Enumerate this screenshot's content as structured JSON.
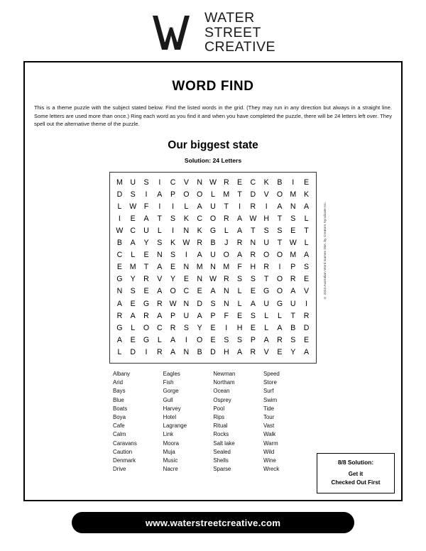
{
  "brand": {
    "logo_icon": "w-monogram-logo",
    "name_lines": [
      "WATER",
      "STREET",
      "CREATIVE"
    ]
  },
  "puzzle": {
    "title": "WORD FIND",
    "instructions": "This is a theme puzzle with the subject stated below. Find the listed words in the grid. (They may run in any direction but always in a straight line. Some letters are used more than once.) Ring each word as you find it and when you have completed the puzzle, there will be 24 letters left over. They spell out the alternative theme of the puzzle.",
    "theme": "Our biggest state",
    "solution_count": "Solution: 24 Letters",
    "copyright": "© 2024 Australian Word Games Dist. by Creators Syndicate Inc.",
    "grid": [
      [
        "M",
        "U",
        "S",
        "I",
        "C",
        "V",
        "N",
        "W",
        "R",
        "E",
        "C",
        "K",
        "B",
        "I",
        "E"
      ],
      [
        "D",
        "S",
        "I",
        "A",
        "P",
        "O",
        "O",
        "L",
        "M",
        "T",
        "D",
        "V",
        "O",
        "M",
        "K"
      ],
      [
        "L",
        "W",
        "F",
        "I",
        "I",
        "L",
        "A",
        "U",
        "T",
        "I",
        "R",
        "I",
        "A",
        "N",
        "A"
      ],
      [
        "I",
        "E",
        "A",
        "T",
        "S",
        "K",
        "C",
        "O",
        "R",
        "A",
        "W",
        "H",
        "T",
        "S",
        "L"
      ],
      [
        "W",
        "C",
        "U",
        "L",
        "I",
        "N",
        "K",
        "G",
        "L",
        "A",
        "T",
        "S",
        "S",
        "E",
        "T"
      ],
      [
        "B",
        "A",
        "Y",
        "S",
        "K",
        "W",
        "R",
        "B",
        "J",
        "R",
        "N",
        "U",
        "T",
        "W",
        "L"
      ],
      [
        "C",
        "L",
        "E",
        "N",
        "S",
        "I",
        "A",
        "U",
        "O",
        "A",
        "R",
        "O",
        "O",
        "M",
        "A"
      ],
      [
        "E",
        "M",
        "T",
        "A",
        "E",
        "N",
        "M",
        "N",
        "M",
        "F",
        "H",
        "R",
        "I",
        "P",
        "S"
      ],
      [
        "G",
        "Y",
        "R",
        "V",
        "Y",
        "E",
        "N",
        "W",
        "R",
        "S",
        "S",
        "T",
        "O",
        "R",
        "E"
      ],
      [
        "N",
        "S",
        "E",
        "A",
        "O",
        "C",
        "E",
        "A",
        "N",
        "L",
        "E",
        "G",
        "O",
        "A",
        "V"
      ],
      [
        "A",
        "E",
        "G",
        "R",
        "W",
        "N",
        "D",
        "S",
        "N",
        "L",
        "A",
        "U",
        "G",
        "U",
        "I"
      ],
      [
        "R",
        "A",
        "R",
        "A",
        "P",
        "U",
        "A",
        "P",
        "F",
        "E",
        "S",
        "L",
        "L",
        "T",
        "R"
      ],
      [
        "G",
        "L",
        "O",
        "C",
        "R",
        "S",
        "Y",
        "E",
        "I",
        "H",
        "E",
        "L",
        "A",
        "B",
        "D"
      ],
      [
        "A",
        "E",
        "G",
        "L",
        "A",
        "I",
        "O",
        "E",
        "S",
        "S",
        "P",
        "A",
        "R",
        "S",
        "E"
      ],
      [
        "L",
        "D",
        "I",
        "R",
        "A",
        "N",
        "B",
        "D",
        "H",
        "A",
        "R",
        "V",
        "E",
        "Y",
        "A"
      ]
    ],
    "word_columns": [
      [
        "Albany",
        "Arid",
        "Bays",
        "Blue",
        "Boats",
        "Boya",
        "Cafe",
        "Calm",
        "Caravans",
        "Caution",
        "Denmark",
        "Drive"
      ],
      [
        "Eagles",
        "Fish",
        "Gorge",
        "Gull",
        "Harvey",
        "Hotel",
        "Lagrange",
        "Link",
        "Moora",
        "Muja",
        "Music",
        "Nacre"
      ],
      [
        "Newman",
        "Northam",
        "Ocean",
        "Osprey",
        "Pool",
        "Rips",
        "Ritual",
        "Rocks",
        "Salt lake",
        "Sealed",
        "Shells",
        "Sparse"
      ],
      [
        "Speed",
        "Store",
        "Surf",
        "Swim",
        "Tide",
        "Tour",
        "Vast",
        "Walk",
        "Warm",
        "Wild",
        "Wine",
        "Wreck"
      ]
    ]
  },
  "answer_box": {
    "heading": "8/8 Solution:",
    "lines": [
      "Get it",
      "Checked Out First"
    ]
  },
  "footer": {
    "website": "www.waterstreetcreative.com"
  },
  "colors": {
    "ink": "#000000",
    "paper": "#ffffff"
  }
}
